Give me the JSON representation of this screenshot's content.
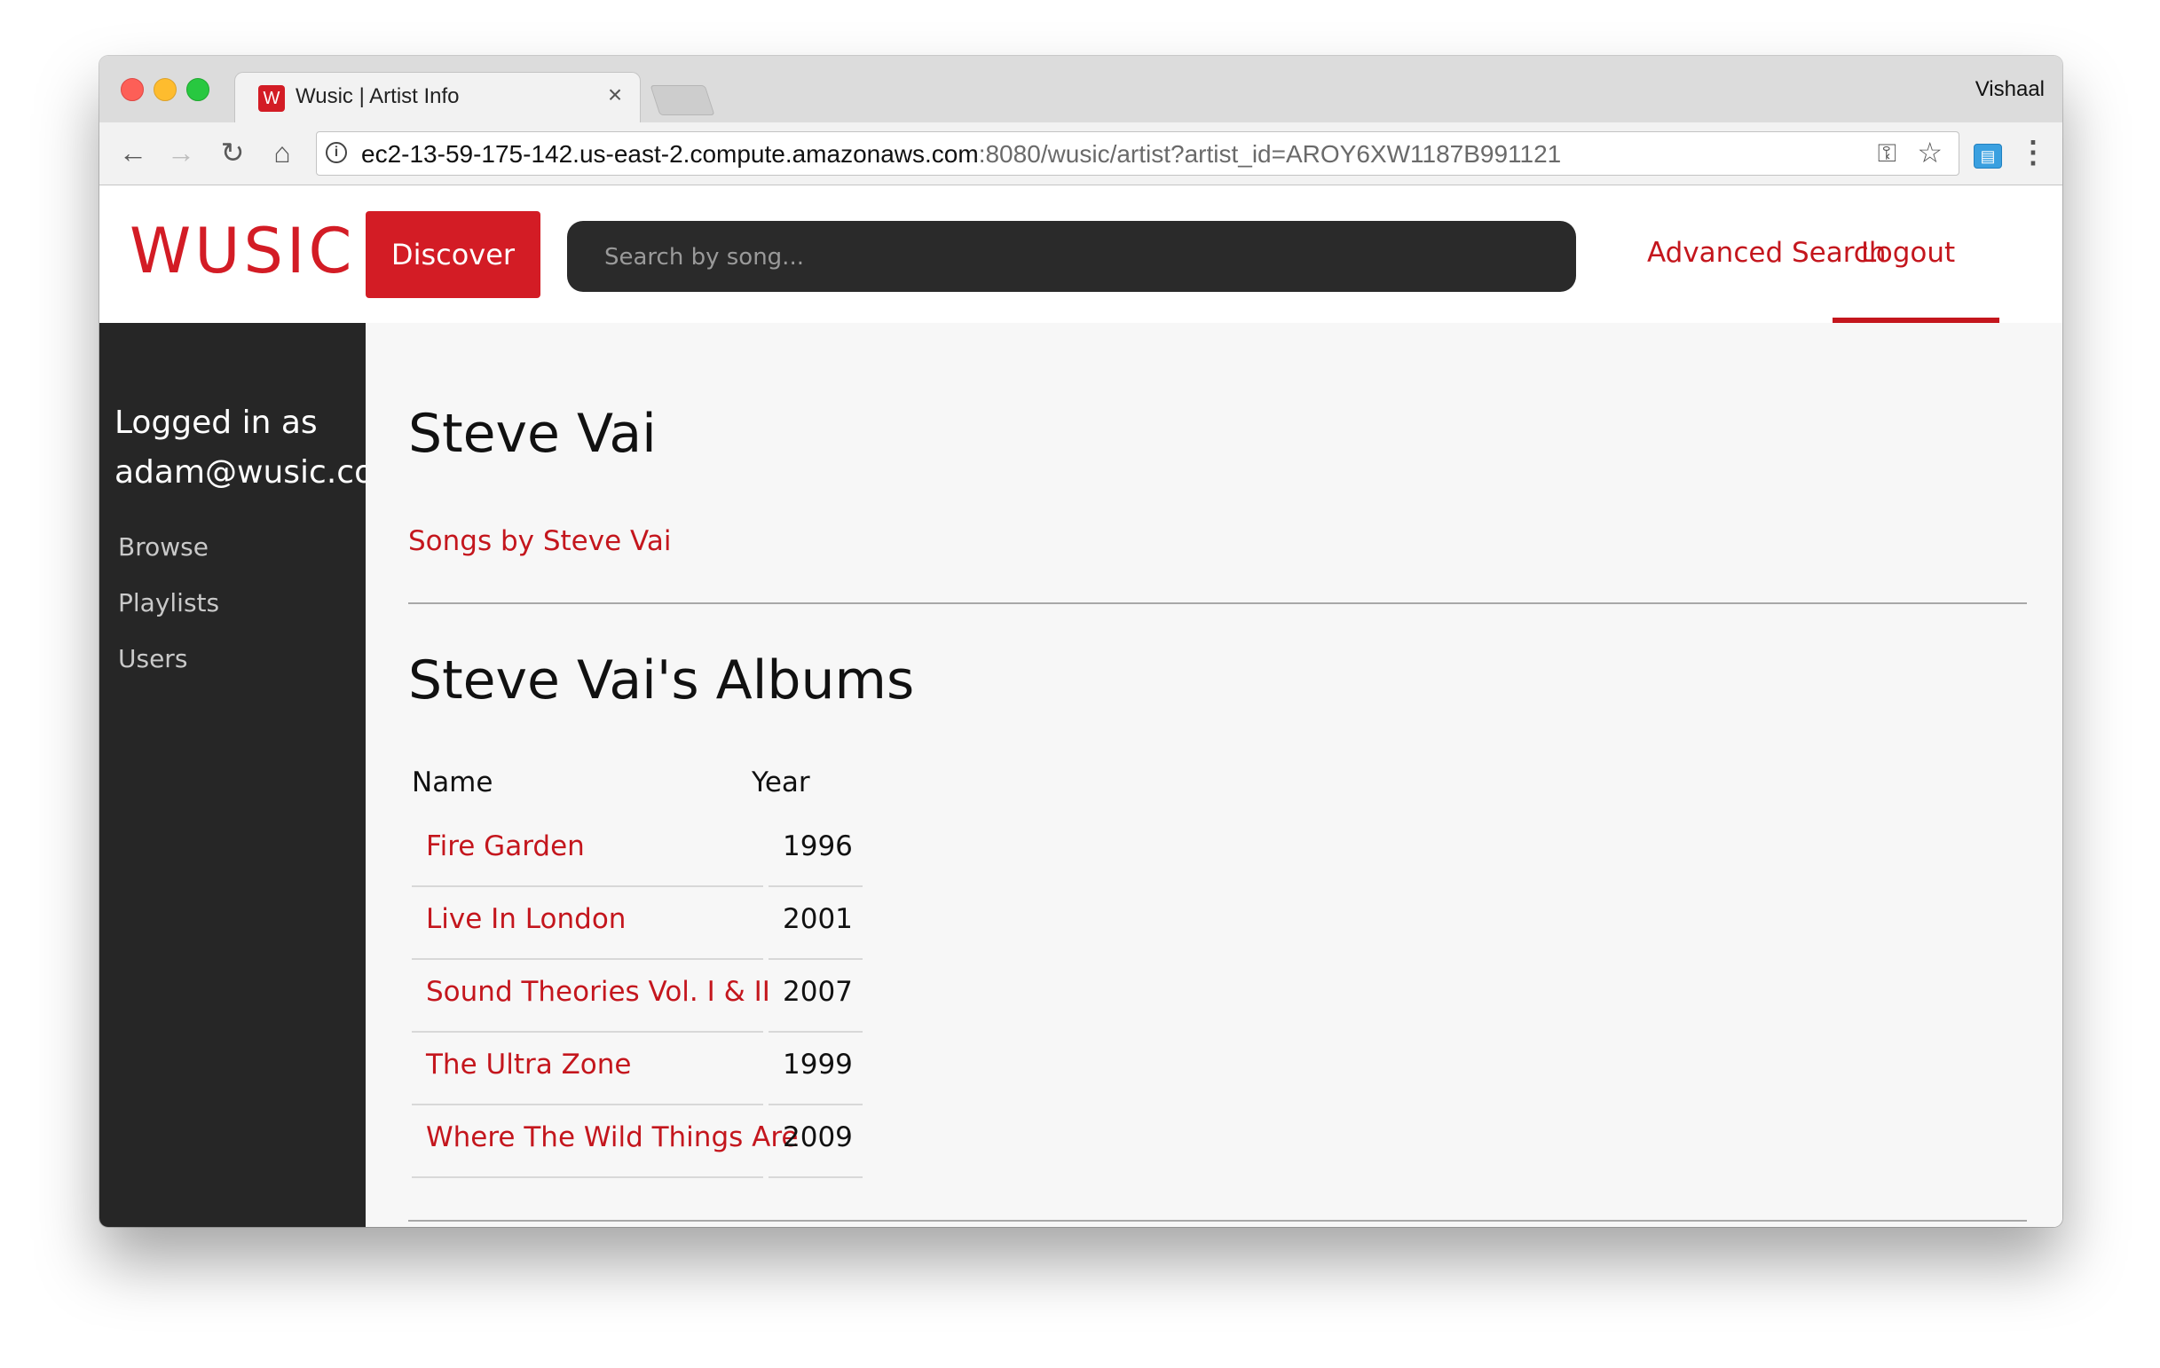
{
  "browser": {
    "tab_title": "Wusic | Artist Info",
    "profile_name": "Vishaal",
    "url_host": "ec2-13-59-175-142.us-east-2.compute.amazonaws.com",
    "url_path": ":8080/wusic/artist?artist_id=AROY6XW1187B991121"
  },
  "header": {
    "logo": "WUSIC",
    "discover_label": "Discover",
    "search_placeholder": "Search by song...",
    "advanced_search_label": "Advanced Search",
    "logout_label": "Logout",
    "accent_color": "#d31c25"
  },
  "sidebar": {
    "logged_in_label": "Logged in as",
    "user_email": "adam@wusic.com",
    "items": [
      {
        "label": "Browse"
      },
      {
        "label": "Playlists"
      },
      {
        "label": "Users"
      }
    ]
  },
  "main": {
    "artist_name": "Steve Vai",
    "songs_link": "Songs by Steve Vai",
    "albums_heading": "Steve Vai's Albums",
    "table_headers": [
      "Name",
      "Year"
    ],
    "albums": [
      {
        "name": "Fire Garden",
        "year": "1996"
      },
      {
        "name": "Live In London",
        "year": "2001"
      },
      {
        "name": "Sound Theories Vol. I & II",
        "year": "2007"
      },
      {
        "name": "The Ultra Zone",
        "year": "1999"
      },
      {
        "name": "Where The Wild Things Are",
        "year": "2009"
      }
    ]
  }
}
